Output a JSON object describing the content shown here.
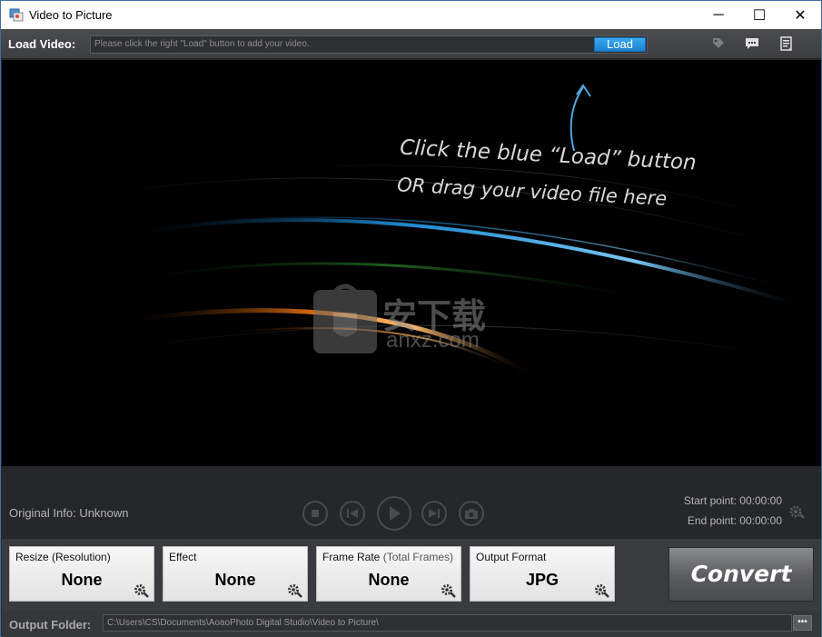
{
  "window": {
    "title": "Video to Picture",
    "minimize_glyph": "─",
    "maximize_glyph": "☐",
    "close_glyph": "✕"
  },
  "load_bar": {
    "label": "Load Video:",
    "placeholder": "Please click the right \"Load\" button to add your video.",
    "load_button": "Load",
    "icons": [
      "tag-icon",
      "comment-icon",
      "list-icon"
    ]
  },
  "preview": {
    "hint_line1": "Click the blue “Load” button",
    "hint_line2": "OR drag your video file here",
    "watermark_text": "安下载",
    "watermark_sub": "anxz.com"
  },
  "playback": {
    "original_info": "Original Info: Unknown",
    "start_point": "Start point: 00:00:00",
    "end_point": "End point: 00:00:00"
  },
  "options": [
    {
      "title": "Resize (Resolution)",
      "subtitle": "",
      "value": "None"
    },
    {
      "title": "Effect",
      "subtitle": "",
      "value": "None"
    },
    {
      "title": "Frame Rate",
      "subtitle": " (Total Frames)",
      "value": "None"
    },
    {
      "title": "Output Format",
      "subtitle": "",
      "value": "JPG"
    }
  ],
  "convert_button": "Convert",
  "output": {
    "label": "Output Folder:",
    "path": "C:\\Users\\CS\\Documents\\AoaoPhoto Digital Studio\\Video to Picture\\",
    "browse_label": "•••"
  },
  "colors": {
    "accent_blue": "#1b7fcf",
    "background_dark": "#2a2b2d"
  }
}
